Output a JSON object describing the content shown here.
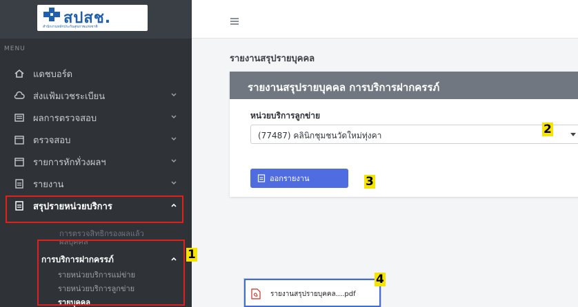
{
  "brand": {
    "logo_text": "สปสช.",
    "logo_subtitle": "สำนักงานหลักประกันสุขภาพแห่งชาติ"
  },
  "sidebar": {
    "menu_heading": "MENU",
    "items": [
      {
        "label": "แดชบอร์ด",
        "icon": "home-icon",
        "chevron": false
      },
      {
        "label": "ส่งแฟ้มเวชระเบียน",
        "icon": "cloud-upload-icon",
        "chevron": true
      },
      {
        "label": "ผลการตรวจสอบ",
        "icon": "list-icon",
        "chevron": true
      },
      {
        "label": "ตรวจสอบ",
        "icon": "calendar-icon",
        "chevron": true
      },
      {
        "label": "รายการหักทั่วงผลฯ",
        "icon": "calendar-icon",
        "chevron": true
      },
      {
        "label": "รายงาน",
        "icon": "document-icon",
        "chevron": true
      },
      {
        "label": "สรุปรายหน่วยบริการ",
        "icon": "document-icon",
        "chevron": true
      }
    ],
    "sub_items": [
      "การตรวจสิทธิกรองผลแล้ว",
      "ผลบุคคล",
      "การบริการฝากครรภ์",
      "รายหน่วยบริการแม่ข่าย",
      "รายหน่วยบริการลูกข่าย",
      "รายบุคคล"
    ]
  },
  "main": {
    "page_title": "รายงานสรุปรายบุคคล",
    "card_title": "รายงานสรุปรายบุคคล การบริการฝากครรภ์",
    "field_label": "หน่วยบริการลูกข่าย",
    "select_value": "(77487) คลินิกชุมชนวัดใหม่ทุ่งคา",
    "export_button": "ออกรายงาน"
  },
  "download": {
    "file_name": "รายงานสรุปรายบุคคล....pdf"
  },
  "annotations": {
    "n1": "1",
    "n2": "2",
    "n3": "3",
    "n4": "4"
  },
  "colors": {
    "sidebar_bg": "#2f3338",
    "card_header_bg": "#707780",
    "button_bg": "#4f6de0",
    "highlight_red": "#e0201c",
    "badge_yellow": "#f5e400"
  }
}
